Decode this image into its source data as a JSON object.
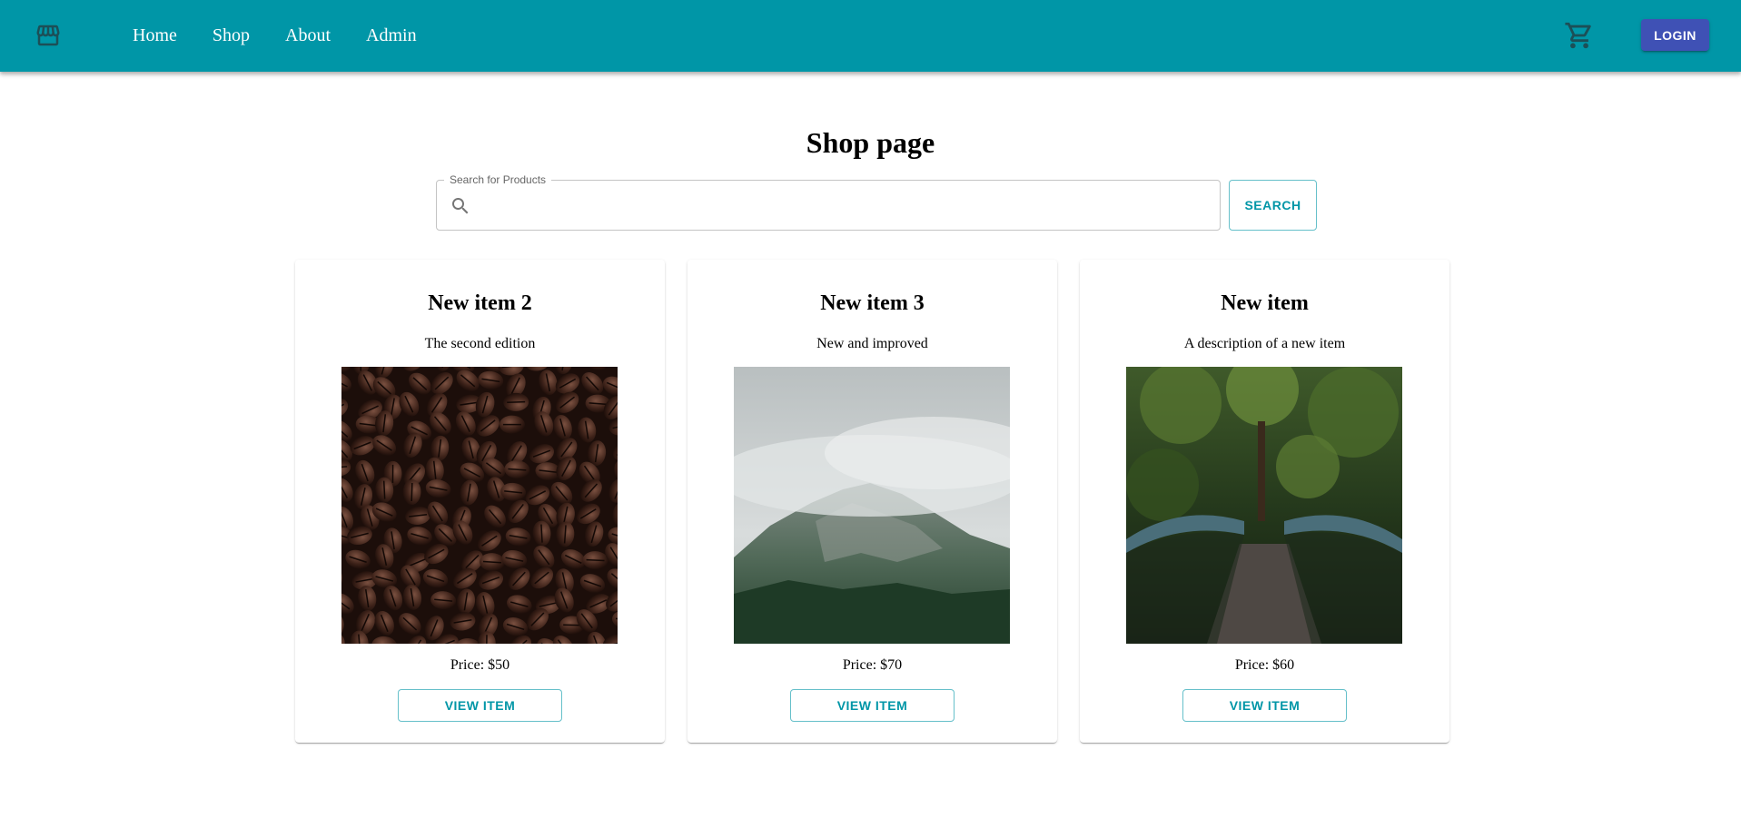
{
  "header": {
    "logo_icon": "storefront-icon",
    "nav": [
      "Home",
      "Shop",
      "About",
      "Admin"
    ],
    "cart_icon": "shopping-cart-icon",
    "login_label": "LOGIN",
    "bar_color": "#0096a7",
    "login_color": "#3f51b5"
  },
  "main": {
    "title": "Shop page",
    "search": {
      "label": "Search for Products",
      "value": "",
      "icon": "search-icon",
      "button_label": "SEARCH"
    },
    "products": [
      {
        "title": "New item 2",
        "description": "The second edition",
        "price": "Price: $50",
        "image": "coffee-beans-photo",
        "button_label": "VIEW ITEM"
      },
      {
        "title": "New item 3",
        "description": "New and improved",
        "price": "Price: $70",
        "image": "misty-mountain-photo",
        "button_label": "VIEW ITEM"
      },
      {
        "title": "New item",
        "description": "A description of a new item",
        "price": "Price: $60",
        "image": "forest-bridge-photo",
        "button_label": "VIEW ITEM"
      }
    ]
  }
}
